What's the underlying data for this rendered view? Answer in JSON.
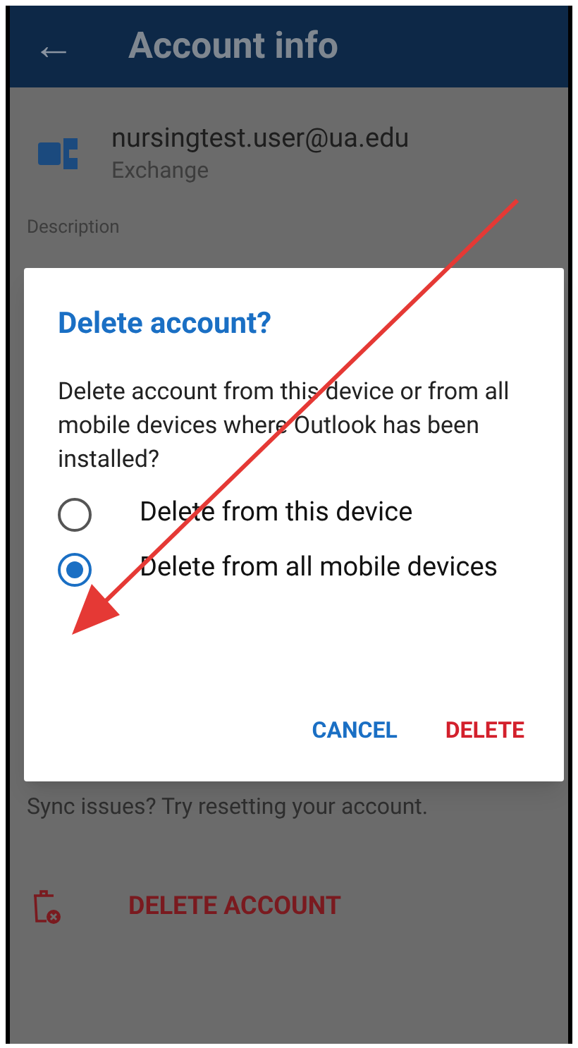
{
  "header": {
    "back": "←",
    "title": "Account info"
  },
  "account": {
    "email": "nursingtest.user@ua.edu",
    "type": "Exchange"
  },
  "description_label": "Description",
  "sync_hint": "Sync issues? Try resetting your account.",
  "delete_account": "DELETE ACCOUNT",
  "dialog": {
    "title": "Delete account?",
    "message": "Delete account from this device or from all mobile devices where Outlook has been installed?",
    "options": [
      {
        "label": "Delete from this device",
        "selected": false
      },
      {
        "label": "Delete from all mobile devices",
        "selected": true
      }
    ],
    "buttons": [
      {
        "label": "CANCEL",
        "kind": "neutral"
      },
      {
        "label": "DELETE",
        "kind": "destructive"
      }
    ]
  }
}
